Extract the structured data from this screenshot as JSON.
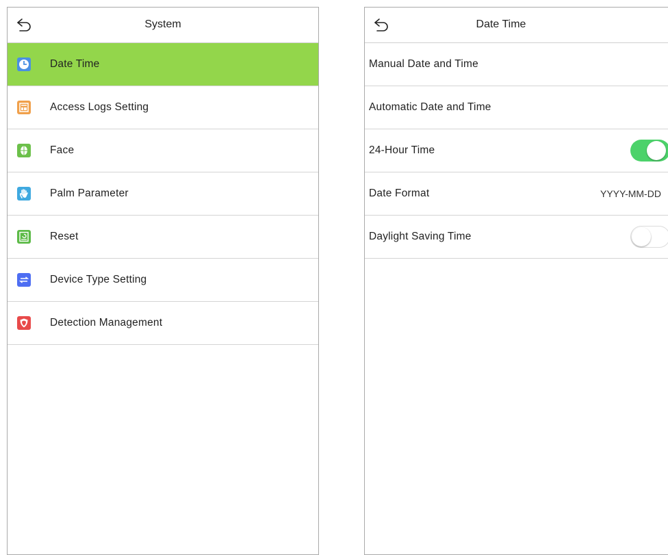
{
  "colors": {
    "active_row": "#93d64b",
    "toggle_on": "#4cd26a"
  },
  "left_screen": {
    "title": "System",
    "back_icon": "back-arrow-icon",
    "items": [
      {
        "label": "Date Time",
        "icon": "clock-icon",
        "color": "#4a90e2",
        "active": true
      },
      {
        "label": "Access Logs Setting",
        "icon": "access-logs-icon",
        "color": "#f0a04b"
      },
      {
        "label": "Face",
        "icon": "face-icon",
        "color": "#6cc04a"
      },
      {
        "label": "Palm Parameter",
        "icon": "palm-icon",
        "color": "#3fa9e0"
      },
      {
        "label": "Reset",
        "icon": "reset-icon",
        "color": "#5cba47"
      },
      {
        "label": "Device Type Setting",
        "icon": "device-type-icon",
        "color": "#4e6ef2"
      },
      {
        "label": "Detection Management",
        "icon": "shield-icon",
        "color": "#e84a4a"
      }
    ]
  },
  "right_screen": {
    "title": "Date Time",
    "back_icon": "back-arrow-icon",
    "items": [
      {
        "label": "Manual Date and Time"
      },
      {
        "label": "Automatic Date and Time"
      },
      {
        "label": "24-Hour Time",
        "toggle": true
      },
      {
        "label": "Date Format",
        "value": "YYYY-MM-DD"
      },
      {
        "label": "Daylight Saving Time",
        "toggle": false
      }
    ]
  }
}
